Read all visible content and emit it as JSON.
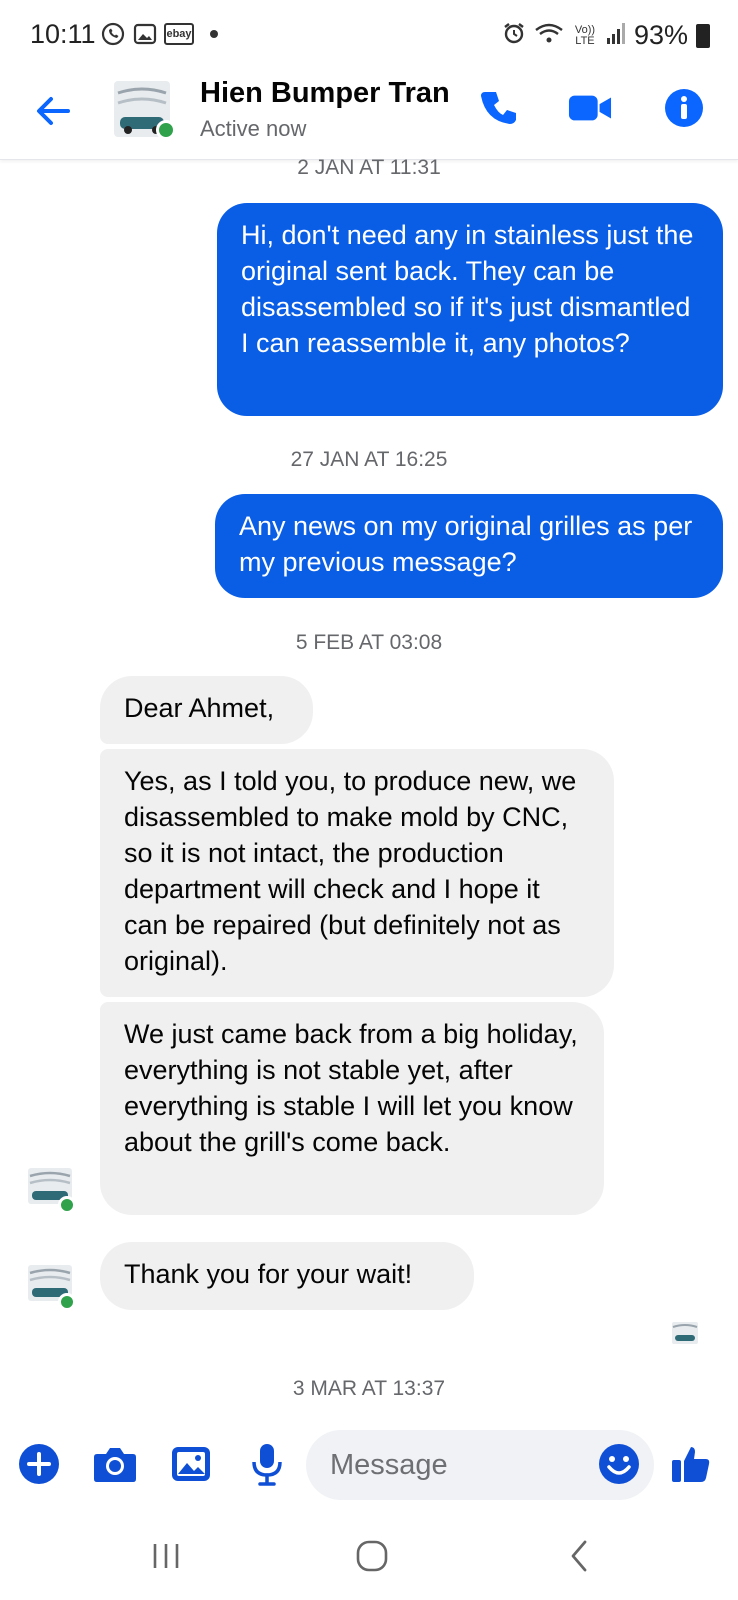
{
  "status_bar": {
    "time": "10:11",
    "ebay_label": "ebay",
    "battery": "93%",
    "network": "Vo)) LTE"
  },
  "header": {
    "contact_name": "Hien Bumper Tran",
    "contact_status": "Active now"
  },
  "messages": [
    {
      "type": "timestamp",
      "text": "2 JAN AT 11:31"
    },
    {
      "type": "outgoing",
      "text": "Hi, don't need any in stainless just the original sent back. They can be disassembled so if it's just dismantled I can reassemble it, any photos?"
    },
    {
      "type": "timestamp",
      "text": "27 JAN AT 16:25"
    },
    {
      "type": "outgoing",
      "text": "Any news on my original grilles as per my previous message?"
    },
    {
      "type": "timestamp",
      "text": "5 FEB AT 03:08"
    },
    {
      "type": "incoming",
      "text": "Dear Ahmet,"
    },
    {
      "type": "incoming",
      "text": "Yes, as I told you, to produce new, we disassembled to make mold by CNC, so it is not intact, the production department will check and I hope it can be repaired (but definitely not as original)."
    },
    {
      "type": "incoming",
      "text": "We just came back from a big holiday, everything is not stable yet, after everything is stable I will let you know about the grill's come back."
    },
    {
      "type": "incoming",
      "text": "Thank you for your wait!"
    },
    {
      "type": "timestamp",
      "text": "3 MAR AT 13:37"
    }
  ],
  "composer": {
    "placeholder": "Message"
  },
  "colors": {
    "accent": "#0a5ee6",
    "online": "#31a24c",
    "incoming_bubble": "#f0f0f0"
  }
}
